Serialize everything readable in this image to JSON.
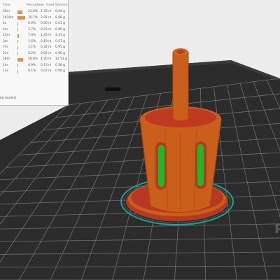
{
  "stats": {
    "headers": {
      "time": "Time",
      "percentage": "Percentage",
      "used_filament": "Used filament"
    },
    "rows": [
      {
        "time": "50m",
        "percentage": "23.0%",
        "length": "2.33 m",
        "weight": "6.94 g",
        "fraction": 0.23
      },
      {
        "time": "1h18m",
        "percentage": "35.7%",
        "length": "2.91 m",
        "weight": "8.68 g",
        "fraction": 0.357
      },
      {
        "time": "4s",
        "percentage": "0.0%",
        "length": "0.00 m",
        "weight": "0.01 g",
        "fraction": 0.0
      },
      {
        "time": "4m",
        "percentage": "1.7%",
        "length": "0.23 m",
        "weight": "0.69 g",
        "fraction": 0.017
      },
      {
        "time": "15m",
        "percentage": "7.0%",
        "length": "1.45 m",
        "weight": "4.31 g",
        "fraction": 0.07
      },
      {
        "time": "3m",
        "percentage": "1.5%",
        "length": "0.19 m",
        "weight": "0.57 g",
        "fraction": 0.015
      },
      {
        "time": "7m",
        "percentage": "3.1%",
        "length": "0.32 m",
        "weight": "0.95 g",
        "fraction": 0.031
      },
      {
        "time": "21s",
        "percentage": "0.2%",
        "length": "0.02 m",
        "weight": "0.06 g",
        "fraction": 0.002
      },
      {
        "time": "58m",
        "percentage": "26.8%",
        "length": "4.20 m",
        "weight": "12.53 g",
        "fraction": 0.268
      },
      {
        "time": "2m",
        "percentage": "0.9%",
        "length": "0.13 m",
        "weight": "0.38 g",
        "fraction": 0.009
      },
      {
        "time": "13s",
        "percentage": "0.1%",
        "length": "0.02 m",
        "weight": "0.06 g",
        "fraction": 0.001
      }
    ],
    "footer": "tal mode)]"
  },
  "bed_label": "P",
  "colors": {
    "bar": "#f08a3c",
    "model": "#c95f1a",
    "model_dark": "#a84812",
    "model_red": "#c03a22",
    "support_green": "#25b525",
    "bed_dark": "#2e2e2e",
    "grid": "#7a7a7a",
    "skirt": "#2a9a92"
  }
}
